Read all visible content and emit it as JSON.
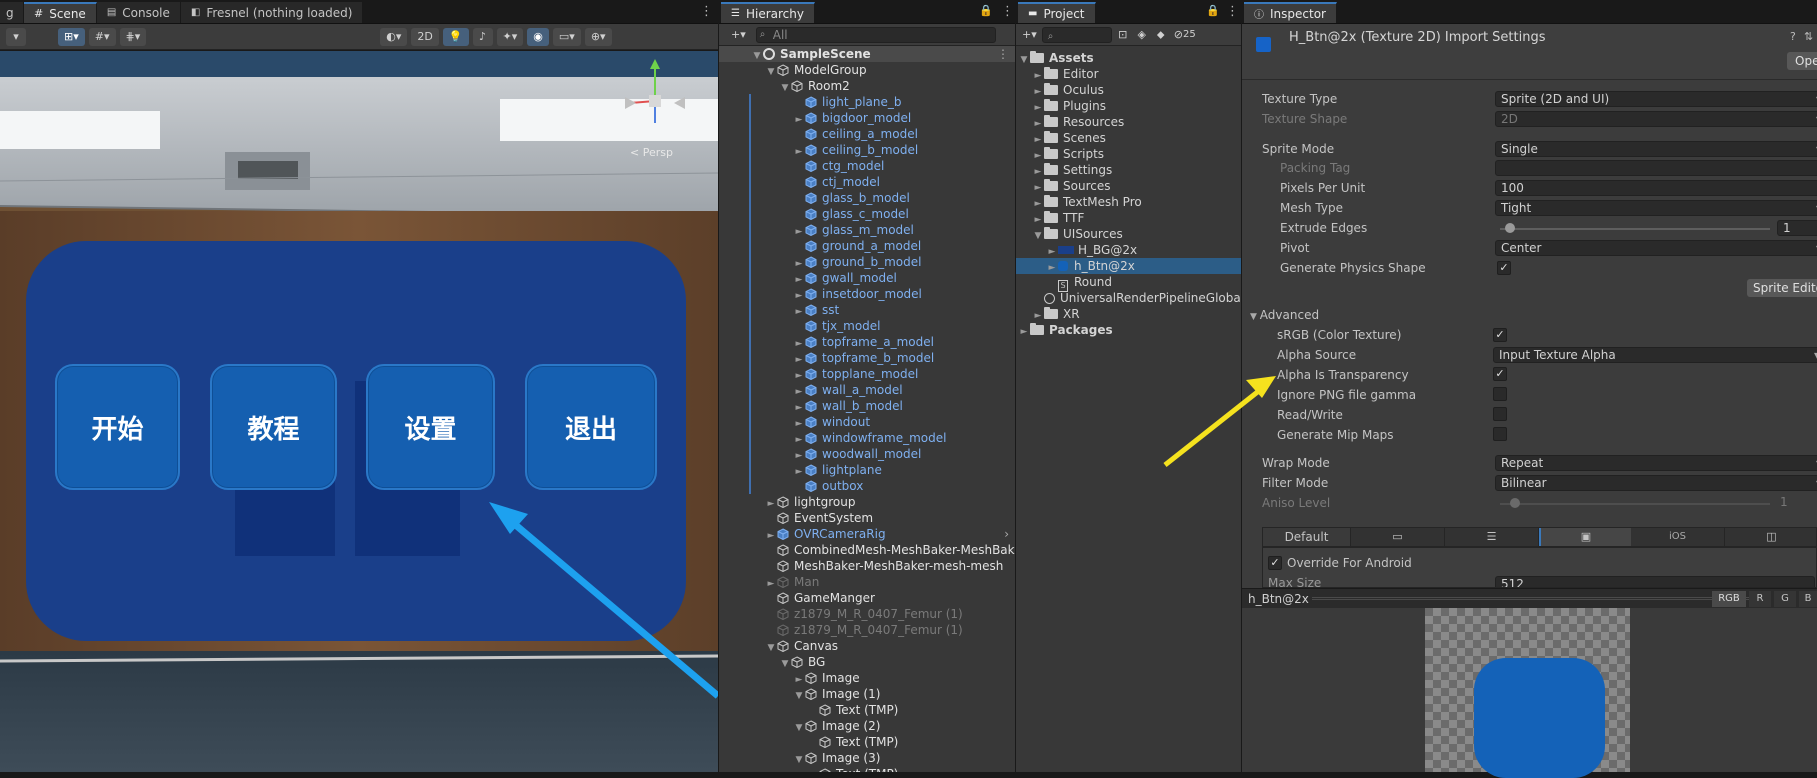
{
  "scene": {
    "tabs": [
      {
        "label": "g"
      },
      {
        "label": "Scene"
      },
      {
        "label": "Console"
      },
      {
        "label": "Fresnel (nothing loaded)"
      }
    ],
    "toolbar": {
      "mode_2d": "2D"
    },
    "persp_label": "< Persp",
    "buttons": [
      "开始",
      "教程",
      "设置",
      "退出"
    ]
  },
  "hierarchy": {
    "tab": "Hierarchy",
    "search_placeholder": "All",
    "items": [
      {
        "label": "SampleScene",
        "depth": 0,
        "arrow": "▼",
        "style": "white",
        "icon": "unity"
      },
      {
        "label": "ModelGroup",
        "depth": 1,
        "arrow": "▼",
        "style": "white"
      },
      {
        "label": "Room2",
        "depth": 2,
        "arrow": "▼",
        "style": "white"
      },
      {
        "label": "light_plane_b",
        "depth": 3,
        "arrow": "",
        "style": "blue"
      },
      {
        "label": "bigdoor_model",
        "depth": 3,
        "arrow": "►",
        "style": "blue"
      },
      {
        "label": "ceiling_a_model",
        "depth": 3,
        "arrow": "",
        "style": "blue"
      },
      {
        "label": "ceiling_b_model",
        "depth": 3,
        "arrow": "►",
        "style": "blue"
      },
      {
        "label": "ctg_model",
        "depth": 3,
        "arrow": "",
        "style": "blue"
      },
      {
        "label": "ctj_model",
        "depth": 3,
        "arrow": "",
        "style": "blue"
      },
      {
        "label": "glass_b_model",
        "depth": 3,
        "arrow": "",
        "style": "blue"
      },
      {
        "label": "glass_c_model",
        "depth": 3,
        "arrow": "",
        "style": "blue"
      },
      {
        "label": "glass_m_model",
        "depth": 3,
        "arrow": "►",
        "style": "blue"
      },
      {
        "label": "ground_a_model",
        "depth": 3,
        "arrow": "",
        "style": "blue"
      },
      {
        "label": "ground_b_model",
        "depth": 3,
        "arrow": "►",
        "style": "blue"
      },
      {
        "label": "gwall_model",
        "depth": 3,
        "arrow": "►",
        "style": "blue"
      },
      {
        "label": "insetdoor_model",
        "depth": 3,
        "arrow": "►",
        "style": "blue"
      },
      {
        "label": "sst",
        "depth": 3,
        "arrow": "►",
        "style": "blue"
      },
      {
        "label": "tjx_model",
        "depth": 3,
        "arrow": "",
        "style": "blue"
      },
      {
        "label": "topframe_a_model",
        "depth": 3,
        "arrow": "►",
        "style": "blue"
      },
      {
        "label": "topframe_b_model",
        "depth": 3,
        "arrow": "►",
        "style": "blue"
      },
      {
        "label": "topplane_model",
        "depth": 3,
        "arrow": "►",
        "style": "blue"
      },
      {
        "label": "wall_a_model",
        "depth": 3,
        "arrow": "►",
        "style": "blue"
      },
      {
        "label": "wall_b_model",
        "depth": 3,
        "arrow": "►",
        "style": "blue"
      },
      {
        "label": "windout",
        "depth": 3,
        "arrow": "►",
        "style": "blue"
      },
      {
        "label": "windowframe_model",
        "depth": 3,
        "arrow": "►",
        "style": "blue"
      },
      {
        "label": "woodwall_model",
        "depth": 3,
        "arrow": "►",
        "style": "blue"
      },
      {
        "label": "lightplane",
        "depth": 3,
        "arrow": "►",
        "style": "blue"
      },
      {
        "label": "outbox",
        "depth": 3,
        "arrow": "",
        "style": "blue"
      },
      {
        "label": "lightgroup",
        "depth": 1,
        "arrow": "►",
        "style": "white"
      },
      {
        "label": "EventSystem",
        "depth": 1,
        "arrow": "",
        "style": "white"
      },
      {
        "label": "OVRCameraRig",
        "depth": 1,
        "arrow": "►",
        "style": "blue"
      },
      {
        "label": "CombinedMesh-MeshBaker-MeshBak",
        "depth": 1,
        "arrow": "",
        "style": "white"
      },
      {
        "label": "MeshBaker-MeshBaker-mesh-mesh",
        "depth": 1,
        "arrow": "",
        "style": "white"
      },
      {
        "label": "Man",
        "depth": 1,
        "arrow": "►",
        "style": "grey"
      },
      {
        "label": "GameManger",
        "depth": 1,
        "arrow": "",
        "style": "white"
      },
      {
        "label": "z1879_M_R_0407_Femur (1)",
        "depth": 1,
        "arrow": "",
        "style": "grey"
      },
      {
        "label": "z1879_M_R_0407_Femur (1)",
        "depth": 1,
        "arrow": "",
        "style": "grey"
      },
      {
        "label": "Canvas",
        "depth": 1,
        "arrow": "▼",
        "style": "white"
      },
      {
        "label": "BG",
        "depth": 2,
        "arrow": "▼",
        "style": "white"
      },
      {
        "label": "Image",
        "depth": 3,
        "arrow": "►",
        "style": "white"
      },
      {
        "label": "Image (1)",
        "depth": 3,
        "arrow": "▼",
        "style": "white"
      },
      {
        "label": "Text (TMP)",
        "depth": 4,
        "arrow": "",
        "style": "white"
      },
      {
        "label": "Image (2)",
        "depth": 3,
        "arrow": "▼",
        "style": "white"
      },
      {
        "label": "Text (TMP)",
        "depth": 4,
        "arrow": "",
        "style": "white"
      },
      {
        "label": "Image (3)",
        "depth": 3,
        "arrow": "▼",
        "style": "white"
      },
      {
        "label": "Text (TMP)",
        "depth": 4,
        "arrow": "",
        "style": "white"
      }
    ]
  },
  "project": {
    "tab": "Project",
    "count": "25",
    "items": [
      {
        "label": "Assets",
        "depth": 0,
        "arrow": "▼",
        "bold": true,
        "kind": "folder"
      },
      {
        "label": "Editor",
        "depth": 1,
        "arrow": "►",
        "kind": "folder"
      },
      {
        "label": "Oculus",
        "depth": 1,
        "arrow": "►",
        "kind": "folder"
      },
      {
        "label": "Plugins",
        "depth": 1,
        "arrow": "►",
        "kind": "folder"
      },
      {
        "label": "Resources",
        "depth": 1,
        "arrow": "►",
        "kind": "folder"
      },
      {
        "label": "Scenes",
        "depth": 1,
        "arrow": "►",
        "kind": "folder"
      },
      {
        "label": "Scripts",
        "depth": 1,
        "arrow": "►",
        "kind": "folder"
      },
      {
        "label": "Settings",
        "depth": 1,
        "arrow": "►",
        "kind": "folder"
      },
      {
        "label": "Sources",
        "depth": 1,
        "arrow": "►",
        "kind": "folder"
      },
      {
        "label": "TextMesh Pro",
        "depth": 1,
        "arrow": "►",
        "kind": "folder"
      },
      {
        "label": "TTF",
        "depth": 1,
        "arrow": "►",
        "kind": "folder"
      },
      {
        "label": "UISources",
        "depth": 1,
        "arrow": "▼",
        "kind": "folder"
      },
      {
        "label": "H_BG@2x",
        "depth": 2,
        "arrow": "►",
        "kind": "sprite-wide"
      },
      {
        "label": "h_Btn@2x",
        "depth": 2,
        "arrow": "►",
        "kind": "sprite",
        "selected": true
      },
      {
        "label": "Round",
        "depth": 2,
        "arrow": "",
        "kind": "script"
      },
      {
        "label": "UniversalRenderPipelineGlobalS",
        "depth": 1,
        "arrow": "",
        "kind": "asset"
      },
      {
        "label": "XR",
        "depth": 1,
        "arrow": "►",
        "kind": "folder"
      },
      {
        "label": "Packages",
        "depth": 0,
        "arrow": "►",
        "bold": true,
        "kind": "folder"
      }
    ]
  },
  "inspector": {
    "tab": "Inspector",
    "title": "H_Btn@2x (Texture 2D) Import Settings",
    "open_button": "Open",
    "texture_type_label": "Texture Type",
    "texture_type_value": "Sprite (2D and UI)",
    "texture_shape_label": "Texture Shape",
    "texture_shape_value": "2D",
    "sprite_mode_label": "Sprite Mode",
    "sprite_mode_value": "Single",
    "packing_tag_label": "Packing Tag",
    "ppu_label": "Pixels Per Unit",
    "ppu_value": "100",
    "mesh_type_label": "Mesh Type",
    "mesh_type_value": "Tight",
    "extrude_label": "Extrude Edges",
    "extrude_value": "1",
    "pivot_label": "Pivot",
    "pivot_value": "Center",
    "gen_physics_label": "Generate Physics Shape",
    "sprite_editor_button": "Sprite Editor",
    "advanced_label": "Advanced",
    "srgb_label": "sRGB (Color Texture)",
    "alpha_source_label": "Alpha Source",
    "alpha_source_value": "Input Texture Alpha",
    "alpha_transp_label": "Alpha Is Transparency",
    "ignore_png_label": "Ignore PNG file gamma",
    "readwrite_label": "Read/Write",
    "mipmaps_label": "Generate Mip Maps",
    "wrap_label": "Wrap Mode",
    "wrap_value": "Repeat",
    "filter_label": "Filter Mode",
    "filter_value": "Bilinear",
    "aniso_label": "Aniso Level",
    "aniso_value": "1",
    "platform_default": "Default",
    "platform_ios": "iOS",
    "override_label": "Override For Android",
    "maxsize_label": "Max Size",
    "maxsize_value": "512",
    "preview_name": "h_Btn@2x",
    "channels": [
      "RGB",
      "R",
      "G",
      "B"
    ]
  }
}
